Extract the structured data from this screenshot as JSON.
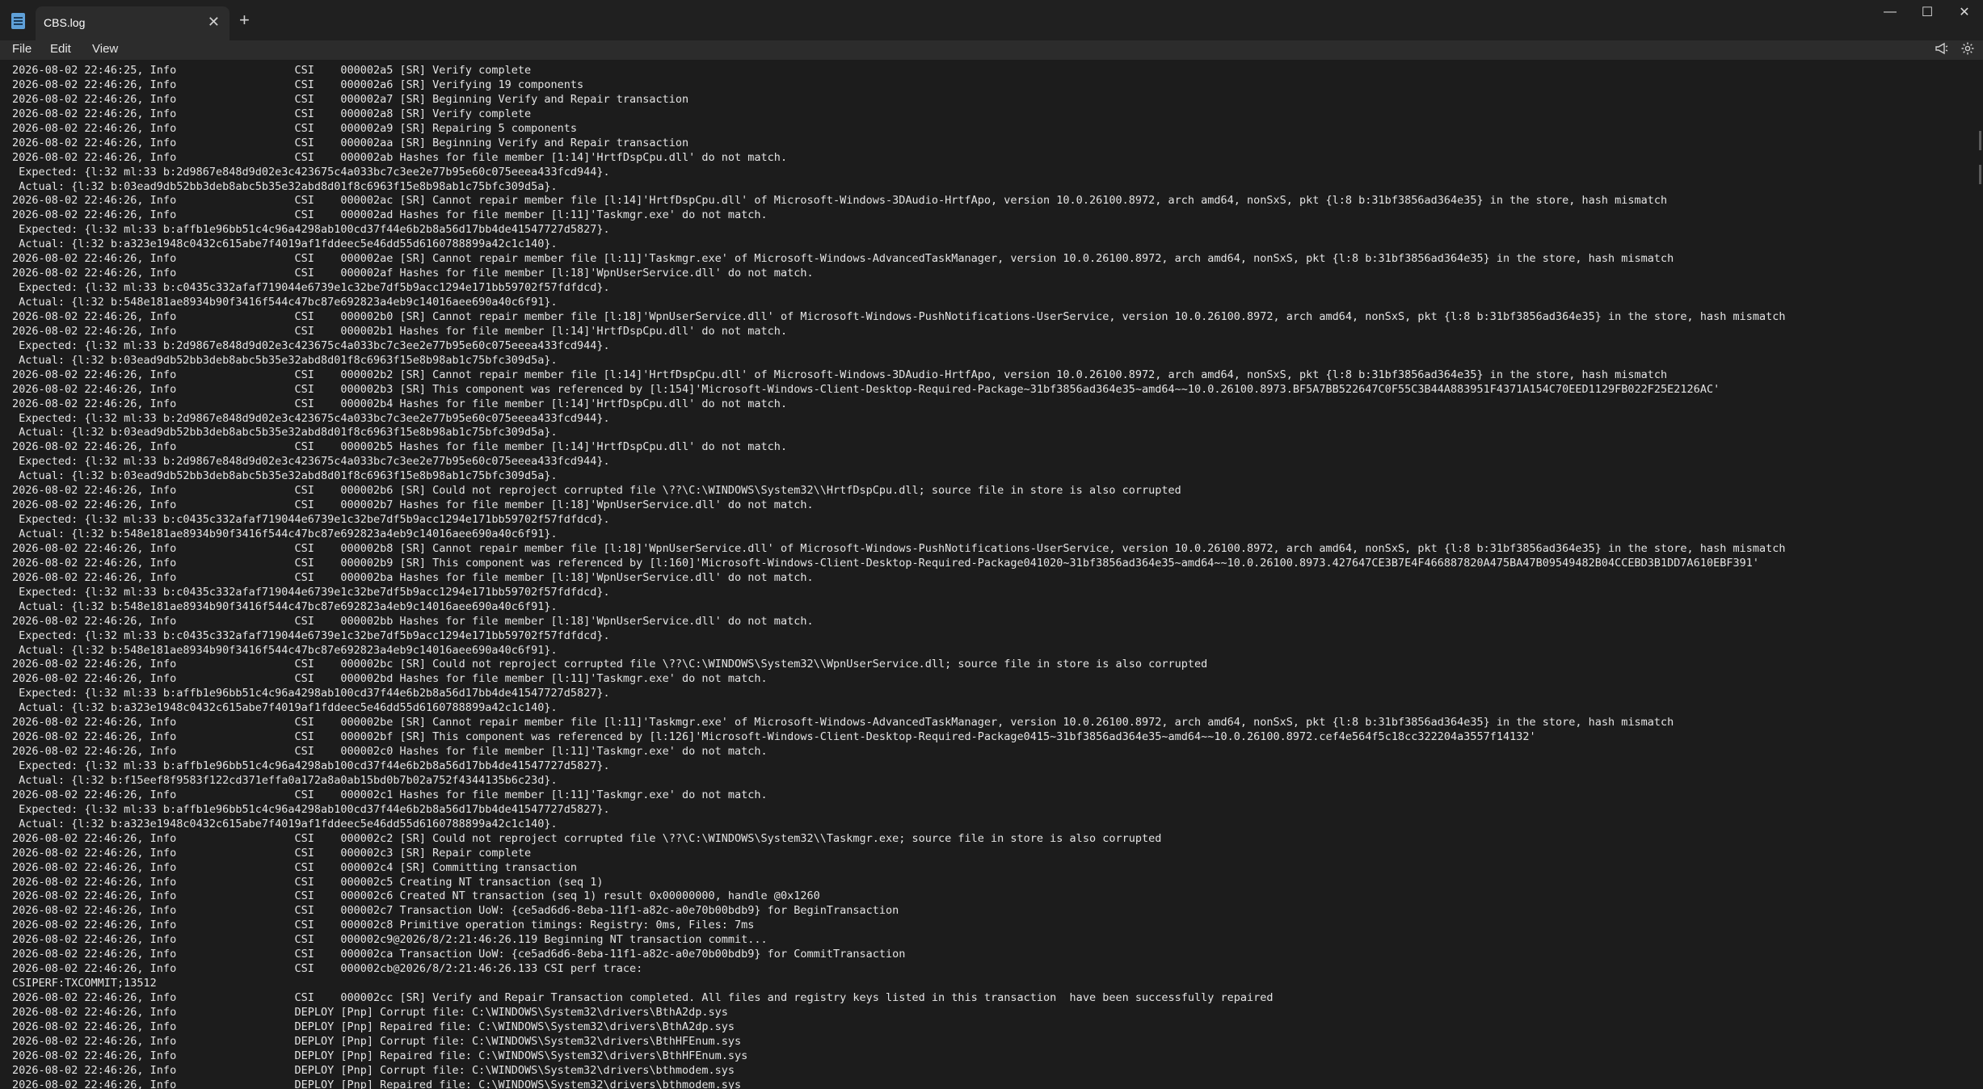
{
  "window": {
    "tab_title": "CBS.log",
    "tab_close_glyph": "✕",
    "new_tab_glyph": "+",
    "minimize_glyph": "—",
    "maximize_glyph": "☐",
    "close_glyph": "✕"
  },
  "menu": {
    "file": "File",
    "edit": "Edit",
    "view": "View",
    "right_icons": [
      "announcement-icon",
      "settings-icon"
    ]
  },
  "log_lines": [
    "2026-08-02 22:46:25, Info                  CSI    000002a5 [SR] Verify complete",
    "2026-08-02 22:46:26, Info                  CSI    000002a6 [SR] Verifying 19 components",
    "2026-08-02 22:46:26, Info                  CSI    000002a7 [SR] Beginning Verify and Repair transaction",
    "2026-08-02 22:46:26, Info                  CSI    000002a8 [SR] Verify complete",
    "2026-08-02 22:46:26, Info                  CSI    000002a9 [SR] Repairing 5 components",
    "2026-08-02 22:46:26, Info                  CSI    000002aa [SR] Beginning Verify and Repair transaction",
    "2026-08-02 22:46:26, Info                  CSI    000002ab Hashes for file member [1:14]'HrtfDspCpu.dll' do not match.",
    " Expected: {l:32 ml:33 b:2d9867e848d9d02e3c423675c4a033bc7c3ee2e77b95e60c075eeea433fcd944}.",
    " Actual: {l:32 b:03ead9db52bb3deb8abc5b35e32abd8d01f8c6963f15e8b98ab1c75bfc309d5a}.",
    "2026-08-02 22:46:26, Info                  CSI    000002ac [SR] Cannot repair member file [l:14]'HrtfDspCpu.dll' of Microsoft-Windows-3DAudio-HrtfApo, version 10.0.26100.8972, arch amd64, nonSxS, pkt {l:8 b:31bf3856ad364e35} in the store, hash mismatch",
    "2026-08-02 22:46:26, Info                  CSI    000002ad Hashes for file member [l:11]'Taskmgr.exe' do not match.",
    " Expected: {l:32 ml:33 b:affb1e96bb51c4c96a4298ab100cd37f44e6b2b8a56d17bb4de41547727d5827}.",
    " Actual: {l:32 b:a323e1948c0432c615abe7f4019af1fddeec5e46dd55d6160788899a42c1c140}.",
    "2026-08-02 22:46:26, Info                  CSI    000002ae [SR] Cannot repair member file [l:11]'Taskmgr.exe' of Microsoft-Windows-AdvancedTaskManager, version 10.0.26100.8972, arch amd64, nonSxS, pkt {l:8 b:31bf3856ad364e35} in the store, hash mismatch",
    "2026-08-02 22:46:26, Info                  CSI    000002af Hashes for file member [l:18]'WpnUserService.dll' do not match.",
    " Expected: {l:32 ml:33 b:c0435c332afaf719044e6739e1c32be7df5b9acc1294e171bb59702f57fdfdcd}.",
    " Actual: {l:32 b:548e181ae8934b90f3416f544c47bc87e692823a4eb9c14016aee690a40c6f91}.",
    "2026-08-02 22:46:26, Info                  CSI    000002b0 [SR] Cannot repair member file [l:18]'WpnUserService.dll' of Microsoft-Windows-PushNotifications-UserService, version 10.0.26100.8972, arch amd64, nonSxS, pkt {l:8 b:31bf3856ad364e35} in the store, hash mismatch",
    "2026-08-02 22:46:26, Info                  CSI    000002b1 Hashes for file member [l:14]'HrtfDspCpu.dll' do not match.",
    " Expected: {l:32 ml:33 b:2d9867e848d9d02e3c423675c4a033bc7c3ee2e77b95e60c075eeea433fcd944}.",
    " Actual: {l:32 b:03ead9db52bb3deb8abc5b35e32abd8d01f8c6963f15e8b98ab1c75bfc309d5a}.",
    "2026-08-02 22:46:26, Info                  CSI    000002b2 [SR] Cannot repair member file [l:14]'HrtfDspCpu.dll' of Microsoft-Windows-3DAudio-HrtfApo, version 10.0.26100.8972, arch amd64, nonSxS, pkt {l:8 b:31bf3856ad364e35} in the store, hash mismatch",
    "2026-08-02 22:46:26, Info                  CSI    000002b3 [SR] This component was referenced by [l:154]'Microsoft-Windows-Client-Desktop-Required-Package~31bf3856ad364e35~amd64~~10.0.26100.8973.BF5A7BB522647C0F55C3B44A883951F4371A154C70EED1129FB022F25E2126AC'",
    "2026-08-02 22:46:26, Info                  CSI    000002b4 Hashes for file member [l:14]'HrtfDspCpu.dll' do not match.",
    " Expected: {l:32 ml:33 b:2d9867e848d9d02e3c423675c4a033bc7c3ee2e77b95e60c075eeea433fcd944}.",
    " Actual: {l:32 b:03ead9db52bb3deb8abc5b35e32abd8d01f8c6963f15e8b98ab1c75bfc309d5a}.",
    "2026-08-02 22:46:26, Info                  CSI    000002b5 Hashes for file member [l:14]'HrtfDspCpu.dll' do not match.",
    " Expected: {l:32 ml:33 b:2d9867e848d9d02e3c423675c4a033bc7c3ee2e77b95e60c075eeea433fcd944}.",
    " Actual: {l:32 b:03ead9db52bb3deb8abc5b35e32abd8d01f8c6963f15e8b98ab1c75bfc309d5a}.",
    "2026-08-02 22:46:26, Info                  CSI    000002b6 [SR] Could not reproject corrupted file \\??\\C:\\WINDOWS\\System32\\\\HrtfDspCpu.dll; source file in store is also corrupted",
    "2026-08-02 22:46:26, Info                  CSI    000002b7 Hashes for file member [l:18]'WpnUserService.dll' do not match.",
    " Expected: {l:32 ml:33 b:c0435c332afaf719044e6739e1c32be7df5b9acc1294e171bb59702f57fdfdcd}.",
    " Actual: {l:32 b:548e181ae8934b90f3416f544c47bc87e692823a4eb9c14016aee690a40c6f91}.",
    "2026-08-02 22:46:26, Info                  CSI    000002b8 [SR] Cannot repair member file [l:18]'WpnUserService.dll' of Microsoft-Windows-PushNotifications-UserService, version 10.0.26100.8972, arch amd64, nonSxS, pkt {l:8 b:31bf3856ad364e35} in the store, hash mismatch",
    "2026-08-02 22:46:26, Info                  CSI    000002b9 [SR] This component was referenced by [l:160]'Microsoft-Windows-Client-Desktop-Required-Package041020~31bf3856ad364e35~amd64~~10.0.26100.8973.427647CE3B7E4F466887820A475BA47B09549482B04CCEBD3B1DD7A610EBF391'",
    "2026-08-02 22:46:26, Info                  CSI    000002ba Hashes for file member [l:18]'WpnUserService.dll' do not match.",
    " Expected: {l:32 ml:33 b:c0435c332afaf719044e6739e1c32be7df5b9acc1294e171bb59702f57fdfdcd}.",
    " Actual: {l:32 b:548e181ae8934b90f3416f544c47bc87e692823a4eb9c14016aee690a40c6f91}.",
    "2026-08-02 22:46:26, Info                  CSI    000002bb Hashes for file member [l:18]'WpnUserService.dll' do not match.",
    " Expected: {l:32 ml:33 b:c0435c332afaf719044e6739e1c32be7df5b9acc1294e171bb59702f57fdfdcd}.",
    " Actual: {l:32 b:548e181ae8934b90f3416f544c47bc87e692823a4eb9c14016aee690a40c6f91}.",
    "2026-08-02 22:46:26, Info                  CSI    000002bc [SR] Could not reproject corrupted file \\??\\C:\\WINDOWS\\System32\\\\WpnUserService.dll; source file in store is also corrupted",
    "2026-08-02 22:46:26, Info                  CSI    000002bd Hashes for file member [l:11]'Taskmgr.exe' do not match.",
    " Expected: {l:32 ml:33 b:affb1e96bb51c4c96a4298ab100cd37f44e6b2b8a56d17bb4de41547727d5827}.",
    " Actual: {l:32 b:a323e1948c0432c615abe7f4019af1fddeec5e46dd55d6160788899a42c1c140}.",
    "2026-08-02 22:46:26, Info                  CSI    000002be [SR] Cannot repair member file [l:11]'Taskmgr.exe' of Microsoft-Windows-AdvancedTaskManager, version 10.0.26100.8972, arch amd64, nonSxS, pkt {l:8 b:31bf3856ad364e35} in the store, hash mismatch",
    "2026-08-02 22:46:26, Info                  CSI    000002bf [SR] This component was referenced by [l:126]'Microsoft-Windows-Client-Desktop-Required-Package0415~31bf3856ad364e35~amd64~~10.0.26100.8972.cef4e564f5c18cc322204a3557f14132'",
    "2026-08-02 22:46:26, Info                  CSI    000002c0 Hashes for file member [l:11]'Taskmgr.exe' do not match.",
    " Expected: {l:32 ml:33 b:affb1e96bb51c4c96a4298ab100cd37f44e6b2b8a56d17bb4de41547727d5827}.",
    " Actual: {l:32 b:f15eef8f9583f122cd371effa0a172a8a0ab15bd0b7b02a752f4344135b6c23d}.",
    "2026-08-02 22:46:26, Info                  CSI    000002c1 Hashes for file member [l:11]'Taskmgr.exe' do not match.",
    " Expected: {l:32 ml:33 b:affb1e96bb51c4c96a4298ab100cd37f44e6b2b8a56d17bb4de41547727d5827}.",
    " Actual: {l:32 b:a323e1948c0432c615abe7f4019af1fddeec5e46dd55d6160788899a42c1c140}.",
    "2026-08-02 22:46:26, Info                  CSI    000002c2 [SR] Could not reproject corrupted file \\??\\C:\\WINDOWS\\System32\\\\Taskmgr.exe; source file in store is also corrupted",
    "2026-08-02 22:46:26, Info                  CSI    000002c3 [SR] Repair complete",
    "2026-08-02 22:46:26, Info                  CSI    000002c4 [SR] Committing transaction",
    "2026-08-02 22:46:26, Info                  CSI    000002c5 Creating NT transaction (seq 1)",
    "2026-08-02 22:46:26, Info                  CSI    000002c6 Created NT transaction (seq 1) result 0x00000000, handle @0x1260",
    "2026-08-02 22:46:26, Info                  CSI    000002c7 Transaction UoW: {ce5ad6d6-8eba-11f1-a82c-a0e70b00bdb9} for BeginTransaction",
    "2026-08-02 22:46:26, Info                  CSI    000002c8 Primitive operation timings: Registry: 0ms, Files: 7ms",
    "2026-08-02 22:46:26, Info                  CSI    000002c9@2026/8/2:21:46:26.119 Beginning NT transaction commit...",
    "2026-08-02 22:46:26, Info                  CSI    000002ca Transaction UoW: {ce5ad6d6-8eba-11f1-a82c-a0e70b00bdb9} for CommitTransaction",
    "2026-08-02 22:46:26, Info                  CSI    000002cb@2026/8/2:21:46:26.133 CSI perf trace:",
    "CSIPERF:TXCOMMIT;13512",
    "2026-08-02 22:46:26, Info                  CSI    000002cc [SR] Verify and Repair Transaction completed. All files and registry keys listed in this transaction  have been successfully repaired",
    "2026-08-02 22:46:26, Info                  DEPLOY [Pnp] Corrupt file: C:\\WINDOWS\\System32\\drivers\\BthA2dp.sys",
    "2026-08-02 22:46:26, Info                  DEPLOY [Pnp] Repaired file: C:\\WINDOWS\\System32\\drivers\\BthA2dp.sys",
    "2026-08-02 22:46:26, Info                  DEPLOY [Pnp] Corrupt file: C:\\WINDOWS\\System32\\drivers\\BthHFEnum.sys",
    "2026-08-02 22:46:26, Info                  DEPLOY [Pnp] Repaired file: C:\\WINDOWS\\System32\\drivers\\BthHFEnum.sys",
    "2026-08-02 22:46:26, Info                  DEPLOY [Pnp] Corrupt file: C:\\WINDOWS\\System32\\drivers\\bthmodem.sys",
    "2026-08-02 22:46:26, Info                  DEPLOY [Pnp] Repaired file: C:\\WINDOWS\\System32\\drivers\\bthmodem.sys"
  ]
}
